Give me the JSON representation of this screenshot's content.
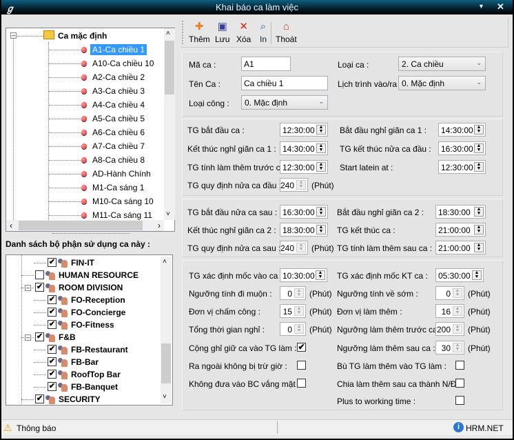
{
  "window": {
    "title": "Khai báo ca làm việc",
    "logo": "app-logo-icon"
  },
  "toolbar": {
    "add": "Thêm",
    "save": "Lưu",
    "delete": "Xóa",
    "print": "In",
    "exit": "Thoát"
  },
  "shift_tree": {
    "root": "Ca mặc định",
    "selected": "A1-Ca chiều 1",
    "items": [
      "A1-Ca chiều 1",
      "A10-Ca chiều 10",
      "A2-Ca chiều 2",
      "A3-Ca chiều 3",
      "A4-Ca chiều 4",
      "A5-Ca chiều 5",
      "A6-Ca chiều 6",
      "A7-Ca chiều 7",
      "A8-Ca chiều 8",
      "AD-Hành Chính",
      "M1-Ca sáng 1",
      "M10-Ca sáng 10",
      "M11-Ca sáng 11"
    ]
  },
  "dept_label": "Danh sách bộ phận sử dụng ca này :",
  "departments": [
    {
      "name": "FIN-IT",
      "checked": true
    },
    {
      "name": "HUMAN RESOURCE",
      "checked": false
    },
    {
      "name": "ROOM DIVISION",
      "checked": true,
      "expanded": true
    },
    {
      "name": "FO-Reception",
      "checked": true
    },
    {
      "name": "FO-Concierge",
      "checked": true
    },
    {
      "name": "FO-Fitness",
      "checked": true
    },
    {
      "name": "F&B",
      "checked": true,
      "expanded": true
    },
    {
      "name": "FB-Restaurant",
      "checked": true
    },
    {
      "name": "FB-Bar",
      "checked": true
    },
    {
      "name": "RoofTop Bar",
      "checked": true
    },
    {
      "name": "FB-Banquet",
      "checked": true
    },
    {
      "name": "SECURITY",
      "checked": true
    }
  ],
  "form": {
    "ma_ca": {
      "label": "Mã ca  :",
      "value": "A1"
    },
    "ten_ca": {
      "label": "Tên Ca :",
      "value": "Ca chiều 1"
    },
    "loai_cong": {
      "label": "Loại công :",
      "value": "0. Mặc định"
    },
    "loai_ca": {
      "label": "Loại ca :",
      "value": "2. Ca chiều"
    },
    "lich_trinh": {
      "label": "Lịch trình vào/ra :",
      "value": "0. Mặc định"
    },
    "unit": "(Phút)",
    "g2": [
      {
        "label": "TG bắt đầu ca :",
        "value": "12:30:00"
      },
      {
        "label": "Bắt đầu nghỉ giãn ca 1 :",
        "value": "14:30:00"
      },
      {
        "label": "Kết thúc nghỉ giãn ca 1 :",
        "value": "14:30:00"
      },
      {
        "label": "TG kết thúc nửa ca đầu :",
        "value": "16:30:00"
      },
      {
        "label": "TG tính làm thêm trước ca :",
        "value": "12:30:00"
      },
      {
        "label": "Start latein at :",
        "value": "12:30:00"
      },
      {
        "label": "TG quy định nửa ca đầu :",
        "value": "240"
      }
    ],
    "g3": [
      {
        "label": "TG bắt đầu nửa ca sau :",
        "value": "16:30:00"
      },
      {
        "label": "Bắt đầu nghỉ giãn ca 2 :",
        "value": "18:30:00"
      },
      {
        "label": "Kết thúc nghỉ giãn ca 2 :",
        "value": "18:30:00"
      },
      {
        "label": "TG kết thúc ca :",
        "value": "21:00:00"
      },
      {
        "label": "TG quy định nửa ca sau :",
        "value": "240"
      },
      {
        "label": "TG tính làm thêm sau ca :",
        "value": "21:00:00"
      }
    ],
    "g4": [
      {
        "label": "TG xác định mốc vào ca :",
        "value": "10:30:00"
      },
      {
        "label": "TG xác định mốc KT ca :",
        "value": "05:30:00"
      },
      {
        "label": "Ngưỡng tính đi muộn :",
        "value": "0"
      },
      {
        "label": "Ngưỡng tính về sớm :",
        "value": "0"
      },
      {
        "label": "Đơn vị chấm công :",
        "value": "15"
      },
      {
        "label": "Đơn vị làm thêm :",
        "value": "16"
      },
      {
        "label": "Tổng thời gian nghỉ :",
        "value": "0"
      },
      {
        "label": "Ngưỡng  làm thêm trước ca :",
        "value": "200"
      },
      {
        "label": "Ngưỡng làm thêm sau ca :",
        "value": "30"
      }
    ],
    "checks": [
      {
        "label": "Cộng ghỉ giữ ca vào TG làm :",
        "checked": true
      },
      {
        "label": "Ra ngoài không bị trừ giờ :",
        "checked": false
      },
      {
        "label": "Không đưa vào BC vắng mặt :",
        "checked": false
      },
      {
        "label": "Bù TG làm thêm vào TG làm :",
        "checked": false
      },
      {
        "label": "Chia làm thêm sau ca thành N/Đ :",
        "checked": false
      },
      {
        "label": "Plus to working time :",
        "checked": false
      }
    ]
  },
  "status": {
    "left": "Thông báo",
    "right": "HRM.NET"
  }
}
